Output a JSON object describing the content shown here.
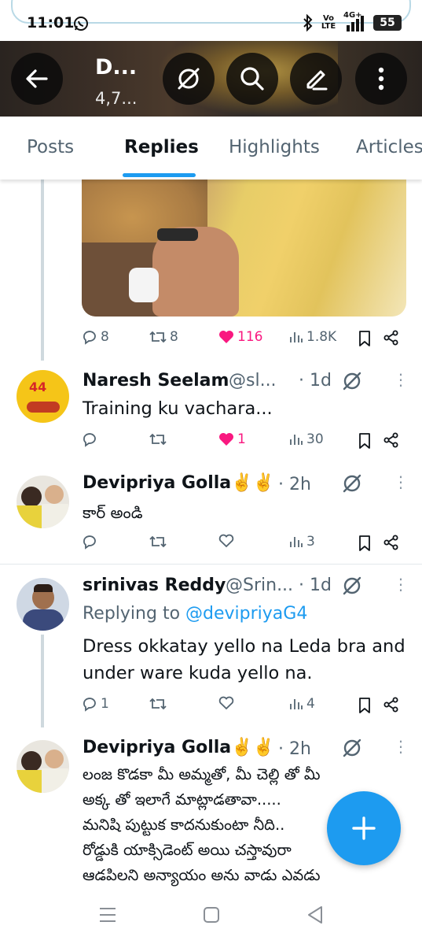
{
  "status_bar": {
    "time": "11:01",
    "network": "4G+",
    "volte": "Vo LTE",
    "battery": "55"
  },
  "header": {
    "title": "D...",
    "subtitle": "4,7..."
  },
  "tabs": [
    {
      "label": "Posts",
      "active": false
    },
    {
      "label": "Replies",
      "active": true
    },
    {
      "label": "Highlights",
      "active": false
    },
    {
      "label": "Articles",
      "active": false
    }
  ],
  "first_post_actions": {
    "replies": "8",
    "reposts": "8",
    "likes": "116",
    "views": "1.8K"
  },
  "replies": [
    {
      "name": "Naresh Seelam",
      "handle": "@sl...",
      "time": "· 1d",
      "text": "Training ku vachara...",
      "actions": {
        "replies": "",
        "reposts": "",
        "likes": "1",
        "liked": true,
        "views": "30"
      }
    },
    {
      "name": "Devipriya Golla✌️✌️",
      "time": "· 2h",
      "text": "కార్ అండి",
      "actions": {
        "replies": "",
        "reposts": "",
        "likes": "",
        "liked": false,
        "views": "3"
      }
    },
    {
      "name": "srinivas Reddy",
      "handle": "@Srin...",
      "time": "· 1d",
      "replying_prefix": "Replying to ",
      "replying_to": "@devipriyaG4",
      "text_lines": [
        "Dress okkatay yello na Leda bra and",
        "under ware kuda yello na."
      ],
      "actions": {
        "replies": "1",
        "reposts": "",
        "likes": "",
        "liked": false,
        "views": "4"
      }
    },
    {
      "name": "Devipriya Golla✌️✌️",
      "time": "· 2h",
      "text_lines": [
        "లంజ కొడకా మీ అమ్మతో, మీ చెల్లి తో మీ",
        "అక్క తో ఇలాగే మాట్లాడతావా.....",
        " మనిషి పుట్టుక కాదనుకుంటా నీది..",
        "రోడ్డుకి యాక్సిడెంట్ అయి చస్తావురా",
        "ఆడపిలని అన్యాయం అను వాడు ఎవడు"
      ]
    }
  ],
  "colors": {
    "accent": "#1d9bf0",
    "like": "#f91880",
    "muted": "#536471"
  }
}
